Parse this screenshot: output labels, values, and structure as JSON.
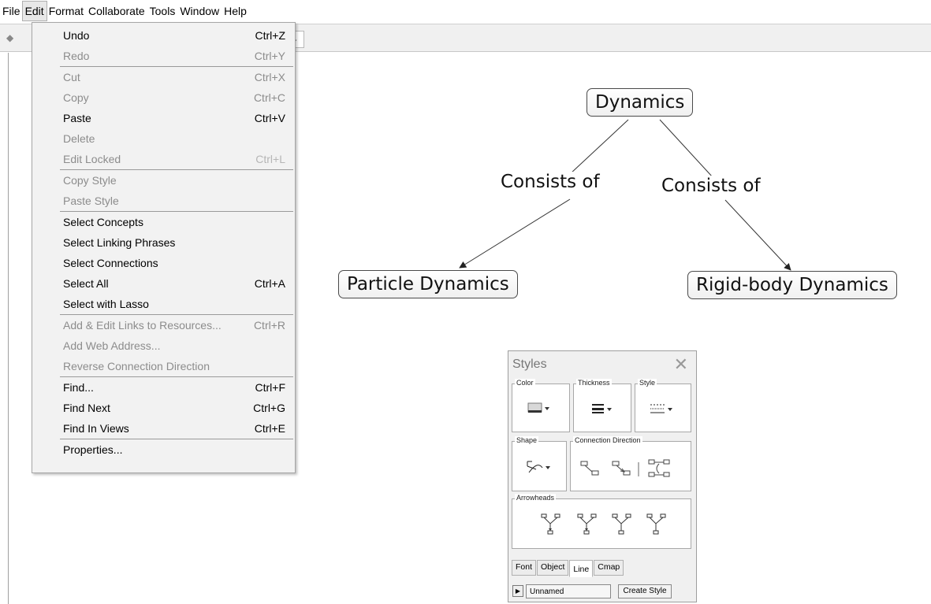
{
  "menubar": {
    "items": [
      "File",
      "Edit",
      "Format",
      "Collaborate",
      "Tools",
      "Window",
      "Help"
    ],
    "active": "Edit"
  },
  "edit_menu": {
    "groups": [
      [
        {
          "label": "Undo",
          "accel": "Ctrl+Z",
          "enabled": true
        },
        {
          "label": "Redo",
          "accel": "Ctrl+Y",
          "enabled": false
        }
      ],
      [
        {
          "label": "Cut",
          "accel": "Ctrl+X",
          "enabled": false
        },
        {
          "label": "Copy",
          "accel": "Ctrl+C",
          "enabled": false
        },
        {
          "label": "Paste",
          "accel": "Ctrl+V",
          "enabled": true
        },
        {
          "label": "Delete",
          "accel": "",
          "enabled": false
        },
        {
          "label": "Edit Locked",
          "accel": "Ctrl+L",
          "enabled": false
        }
      ],
      [
        {
          "label": "Copy Style",
          "accel": "",
          "enabled": false
        },
        {
          "label": "Paste Style",
          "accel": "",
          "enabled": false
        }
      ],
      [
        {
          "label": "Select Concepts",
          "accel": "",
          "enabled": true
        },
        {
          "label": "Select Linking Phrases",
          "accel": "",
          "enabled": true
        },
        {
          "label": "Select Connections",
          "accel": "",
          "enabled": true
        },
        {
          "label": "Select All",
          "accel": "Ctrl+A",
          "enabled": true
        },
        {
          "label": "Select with Lasso",
          "accel": "",
          "enabled": true
        }
      ],
      [
        {
          "label": "Add & Edit Links to Resources...",
          "accel": "Ctrl+R",
          "enabled": false
        },
        {
          "label": "Add Web Address...",
          "accel": "",
          "enabled": false
        },
        {
          "label": "Reverse Connection Direction",
          "accel": "",
          "enabled": false
        }
      ],
      [
        {
          "label": "Find...",
          "accel": "Ctrl+F",
          "enabled": true
        },
        {
          "label": "Find Next",
          "accel": "Ctrl+G",
          "enabled": true
        },
        {
          "label": "Find In Views",
          "accel": "Ctrl+E",
          "enabled": true
        }
      ],
      [
        {
          "label": "Properties...",
          "accel": "",
          "enabled": true
        }
      ]
    ]
  },
  "concept_map": {
    "concepts": {
      "root": "Dynamics",
      "left": "Particle Dynamics",
      "right": "Rigid-body Dynamics"
    },
    "linking_phrases": {
      "left": "Consists of",
      "right": "Consists of"
    }
  },
  "styles_panel": {
    "title": "Styles",
    "groups": {
      "color": "Color",
      "thickness": "Thickness",
      "style": "Style",
      "shape": "Shape",
      "connection_direction": "Connection Direction",
      "arrowheads": "Arrowheads"
    },
    "tabs": [
      "Font",
      "Object",
      "Line",
      "Cmap"
    ],
    "active_tab": "Line",
    "style_name": "Unnamed",
    "create_button": "Create Style"
  },
  "colors": {
    "menu_bg": "#f2f2f2",
    "disabled_text": "#8c8c8c",
    "concept_border": "#4a4a4a"
  }
}
